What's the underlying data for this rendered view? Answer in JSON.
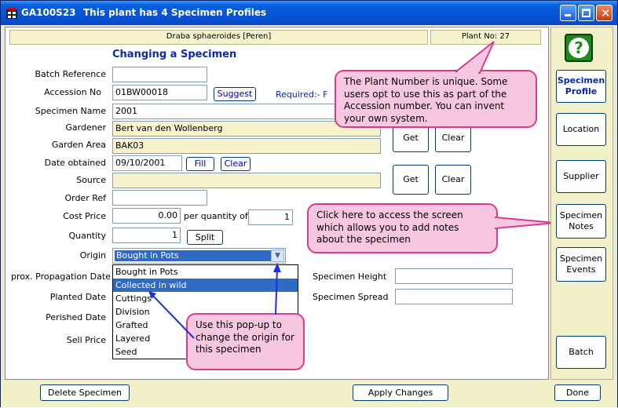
{
  "window": {
    "title_code": "GA100S23",
    "title_text": "This plant has 4 Specimen Profiles",
    "controls": [
      "minimize",
      "maximize",
      "close"
    ]
  },
  "header": {
    "plant_name": "Draba sphaeroides [Peren]",
    "plant_no": "Plant No: 27"
  },
  "heading": "Changing a Specimen",
  "form": {
    "batch_reference": {
      "label": "Batch Reference",
      "value": ""
    },
    "accession_no": {
      "label": "Accession No",
      "value": "01BW00018",
      "suggest": "Suggest",
      "required": "Required:- F"
    },
    "specimen_name": {
      "label": "Specimen Name",
      "value": "2001"
    },
    "gardener": {
      "label": "Gardener",
      "value": "Bert van den Wollenberg"
    },
    "garden_area": {
      "label": "Garden Area",
      "value": "BAK03"
    },
    "date_obtained": {
      "label": "Date obtained",
      "value": "09/10/2001",
      "fill": "Fill",
      "clear": "Clear"
    },
    "source": {
      "label": "Source",
      "value": ""
    },
    "order_ref": {
      "label": "Order Ref",
      "value": ""
    },
    "cost_price": {
      "label": "Cost Price",
      "value": "0.00",
      "per_qty_label": "per quantity of",
      "per_qty": "1"
    },
    "quantity": {
      "label": "Quantity",
      "value": "1",
      "split": "Split"
    },
    "origin": {
      "label": "Origin",
      "value": "Bought in Pots"
    },
    "approx_propagation_date": {
      "label": "prox. Propagation Date"
    },
    "planted_date": {
      "label": "Planted Date"
    },
    "perished_date": {
      "label": "Perished Date"
    },
    "sell_price": {
      "label": "Sell Price"
    },
    "specimen_height": {
      "label": "Specimen Height",
      "value": ""
    },
    "specimen_spread": {
      "label": "Specimen Spread",
      "value": ""
    },
    "get1": "Get",
    "clear1": "Clear",
    "get2": "Get",
    "clear2": "Clear"
  },
  "origin_options": [
    "Bought in Pots",
    "Collected in wild",
    "Cuttings",
    "Division",
    "Grafted",
    "Layered",
    "Seed"
  ],
  "origin_highlighted": "Collected in wild",
  "callouts": {
    "plant_number": "The Plant Number is unique. Some users opt to use this as part of the Accession number. You can invent your own system.",
    "notes": "Click here to access the screen which allows you to add notes about the specimen",
    "popup": "Use this pop-up to change the origin for this specimen"
  },
  "sidebar": {
    "help_icon": "question-icon",
    "items": [
      {
        "label": "Specimen Profile"
      },
      {
        "label": "Location"
      },
      {
        "label": "Supplier"
      },
      {
        "label": "Specimen Notes"
      },
      {
        "label": "Specimen Events"
      },
      {
        "label": "Batch"
      }
    ]
  },
  "bottom": {
    "delete": "Delete Specimen",
    "apply": "Apply Changes",
    "done": "Done"
  },
  "colors": {
    "titlebar": "#0554d6",
    "callout_fill": "#f7c6df",
    "callout_border": "#d93c8f",
    "field_yellow": "#f5f2cc",
    "heading_blue": "#0a2aa8",
    "selection": "#316ac5"
  }
}
